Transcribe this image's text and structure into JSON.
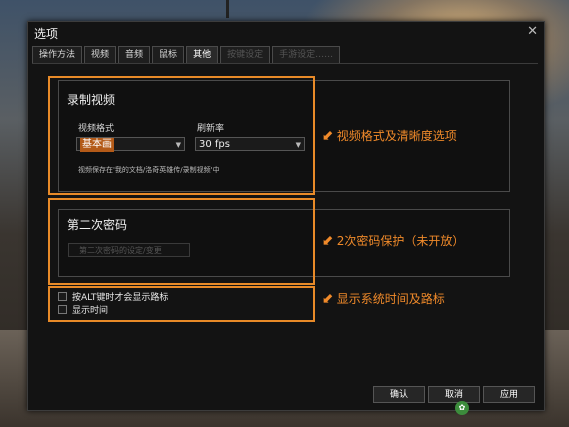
{
  "dialog": {
    "title": "选项",
    "close_icon": "close-icon"
  },
  "tabs": [
    {
      "label": "操作方法"
    },
    {
      "label": "视频"
    },
    {
      "label": "音频"
    },
    {
      "label": "鼠标"
    },
    {
      "label": "其他"
    },
    {
      "label": "按键设定"
    },
    {
      "label": "手游设定……"
    }
  ],
  "record": {
    "title": "录制视频",
    "format_label": "视频格式",
    "format_value": "基本画",
    "rate_label": "刷新率",
    "rate_value": "30 fps",
    "note": "视频保存在'我的文档/洛奇英雄传/录制视频'中"
  },
  "password": {
    "title": "第二次密码",
    "button": "第二次密码的设定/变更"
  },
  "options": [
    {
      "label": "按ALT键时才会显示路标",
      "checked": false
    },
    {
      "label": "显示时间",
      "checked": false
    }
  ],
  "annotations": [
    {
      "text": "视频格式及清晰度选项"
    },
    {
      "text": "2次密码保护（未开放）"
    },
    {
      "text": "显示系统时间及路标"
    }
  ],
  "buttons": {
    "ok": "确认",
    "cancel": "取消",
    "apply": "应用"
  },
  "colors": {
    "accent": "#e88a28",
    "annotation": "#f08a2a"
  }
}
